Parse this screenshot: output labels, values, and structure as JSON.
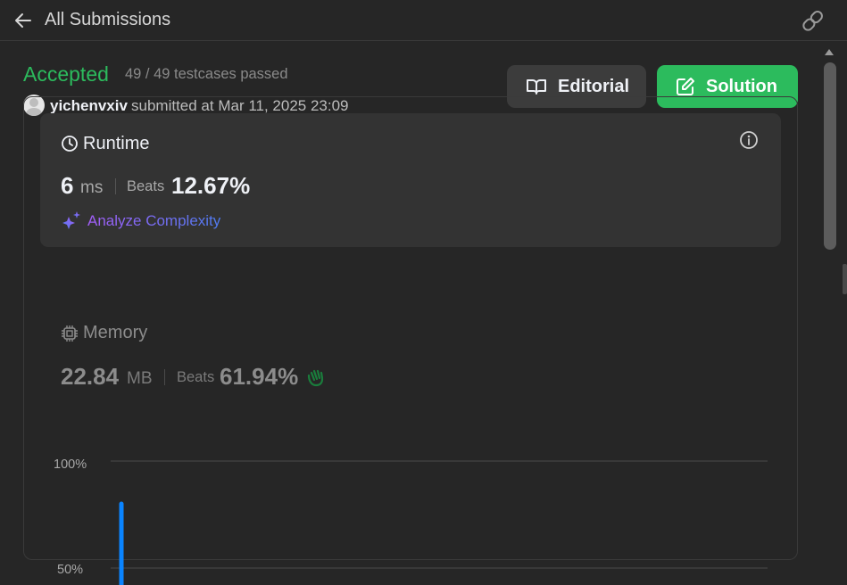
{
  "header": {
    "title": "All Submissions",
    "icons": {
      "back": "arrow-left-icon",
      "link": "link-icon"
    }
  },
  "submission": {
    "status": "Accepted",
    "status_color": "#2cbb5d",
    "testcases": "49 / 49 testcases passed",
    "username": "yichenvxiv",
    "submitted_at": "submitted at Mar 11, 2025 23:09"
  },
  "actions": {
    "editorial_label": "Editorial",
    "solution_label": "Solution",
    "solution_color": "#2cbb5d"
  },
  "runtime": {
    "title": "Runtime",
    "value": "6",
    "unit": "ms",
    "beats_label": "Beats",
    "beats_value": "12.67%",
    "analyze_label": "Analyze Complexity"
  },
  "memory": {
    "title": "Memory",
    "value": "22.84",
    "unit": "MB",
    "beats_label": "Beats",
    "beats_value": "61.94%"
  },
  "chart_data": {
    "type": "bar",
    "y_ticks": [
      "100%",
      "50%"
    ],
    "ylim": [
      0,
      100
    ],
    "bar_color": "#0a84ff",
    "values": [
      80
    ]
  }
}
